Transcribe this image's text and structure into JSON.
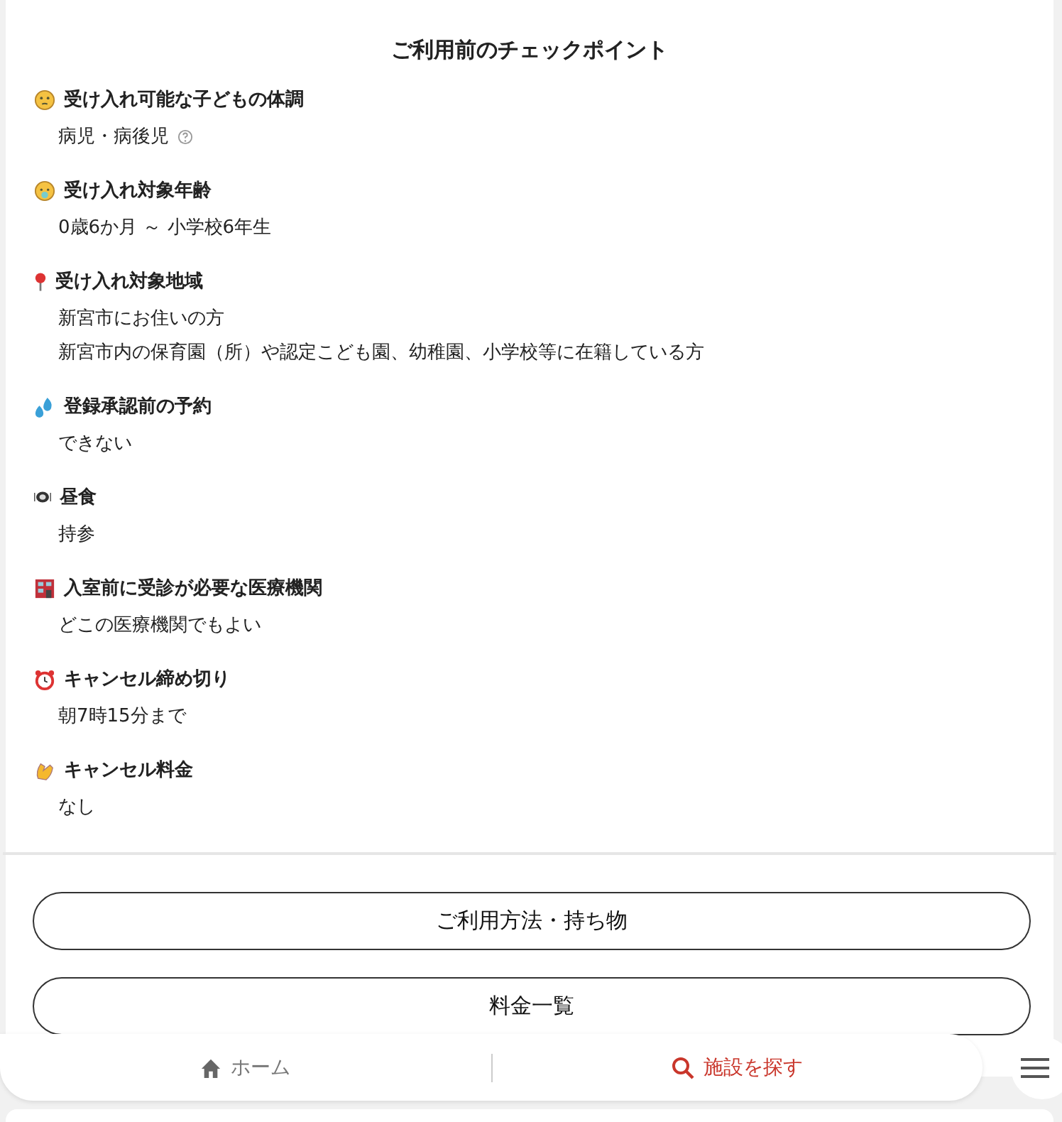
{
  "title": "ご利用前のチェックポイント",
  "items": [
    {
      "label": "受け入れ可能な子どもの体調",
      "values": [
        "病児・病後児"
      ],
      "help": true
    },
    {
      "label": "受け入れ対象年齢",
      "values": [
        "0歳6か月 ～ 小学校6年生"
      ]
    },
    {
      "label": "受け入れ対象地域",
      "values": [
        "新宮市にお住いの方",
        "新宮市内の保育園（所）や認定こども園、幼稚園、小学校等に在籍している方"
      ]
    },
    {
      "label": "登録承認前の予約",
      "values": [
        "できない"
      ]
    },
    {
      "label": "昼食",
      "values": [
        "持参"
      ]
    },
    {
      "label": "入室前に受診が必要な医療機関",
      "values": [
        "どこの医療機関でもよい"
      ]
    },
    {
      "label": "キャンセル締め切り",
      "values": [
        "朝7時15分まで"
      ]
    },
    {
      "label": "キャンセル料金",
      "values": [
        "なし"
      ]
    }
  ],
  "buttons": [
    "ご利用方法・持ち物",
    "料金一覧"
  ],
  "nav": [
    {
      "label": "ホーム",
      "kind": "home",
      "selected": false
    },
    {
      "label": "施設を探す",
      "kind": "search",
      "selected": true
    }
  ]
}
